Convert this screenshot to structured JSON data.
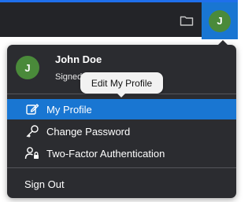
{
  "topbar": {
    "accent_color": "#1f6feb",
    "folder_icon": "folder-icon",
    "avatar_initial": "J",
    "avatar_color": "#4a8a3a",
    "avatar_bg": "#1976d2"
  },
  "dropdown": {
    "profile": {
      "initial": "J",
      "name": "John Doe",
      "signed_in_text": "Signed in as John Doe"
    },
    "items": [
      {
        "label": "My Profile",
        "icon": "edit-icon",
        "active": true
      },
      {
        "label": "Change Password",
        "icon": "key-icon",
        "active": false
      },
      {
        "label": "Two-Factor Authentication",
        "icon": "user-lock-icon",
        "active": false
      }
    ],
    "signout_label": "Sign Out"
  },
  "tooltip": {
    "text": "Edit My Profile"
  }
}
